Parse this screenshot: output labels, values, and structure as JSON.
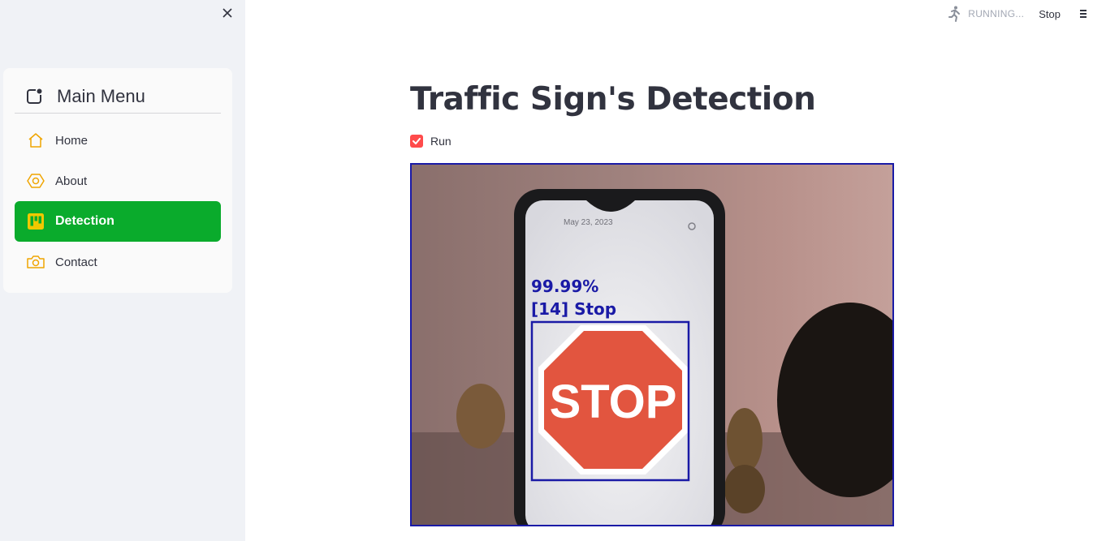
{
  "sidebar": {
    "menu_title": "Main Menu",
    "items": [
      {
        "label": "Home",
        "icon": "house-icon",
        "active": false
      },
      {
        "label": "About",
        "icon": "hexagon-icon",
        "active": false
      },
      {
        "label": "Detection",
        "icon": "kanban-icon",
        "active": true
      },
      {
        "label": "Contact",
        "icon": "camera-icon",
        "active": false
      }
    ]
  },
  "header": {
    "status_text": "RUNNING...",
    "stop_label": "Stop"
  },
  "main": {
    "title": "Traffic Sign's Detection",
    "run_checkbox": {
      "label": "Run",
      "checked": true
    },
    "video": {
      "confidence": "99.99%",
      "detection_label": "[14] Stop",
      "sign_text": "STOP",
      "phone_date": "May 23, 2023"
    }
  },
  "colors": {
    "accent": "#ff4b4b",
    "active_menu": "#0aab2c",
    "icon": "#f0a500",
    "bbox": "#1a1aa6"
  }
}
